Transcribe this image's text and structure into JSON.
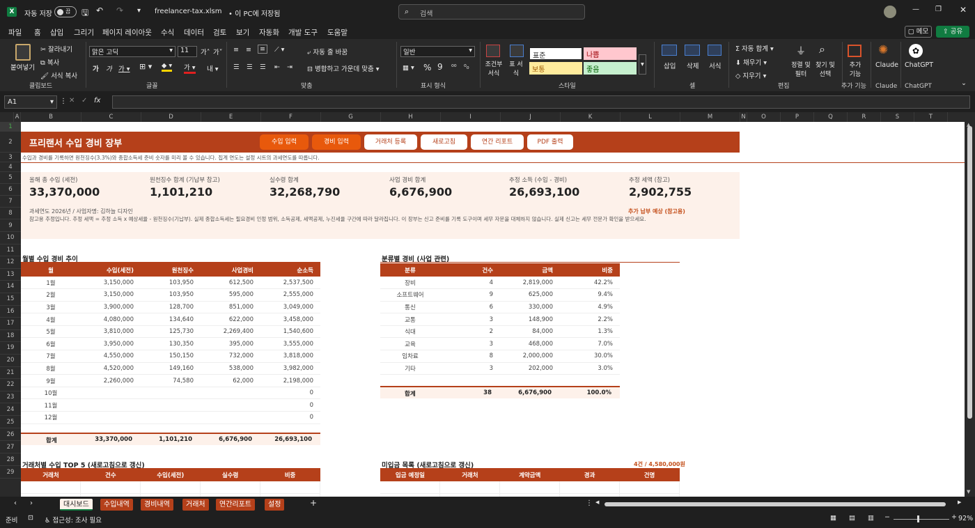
{
  "titlebar": {
    "autosave_label": "자동 저장",
    "autosave_state": "끔",
    "filename": "freelancer-tax.xlsm",
    "saved_status": "• 이 PC에 저장됨",
    "search_placeholder": "검색"
  },
  "menu": [
    "파일",
    "홈",
    "삽입",
    "그리기",
    "페이지 레이아웃",
    "수식",
    "데이터",
    "검토",
    "보기",
    "자동화",
    "개발 도구",
    "도움말"
  ],
  "menu_right": {
    "comment": "메모",
    "share": "공유"
  },
  "ribbon": {
    "paste": "붙여넣기",
    "cut": "잘라내기",
    "copy": "복사",
    "format_painter": "서식 복사",
    "clipboard": "클립보드",
    "font_name": "맑은 고딕",
    "font_size": "11",
    "font_group": "글꼴",
    "wrap": "자동 줄 바꿈",
    "merge": "병합하고 가운데 맞춤",
    "align_group": "맞춤",
    "number_format": "일반",
    "number_group": "표시 형식",
    "cond_format": "조건부 서식",
    "table_format": "표 서식",
    "styles": [
      "표준",
      "나쁨",
      "보통",
      "좋음"
    ],
    "styles_group": "스타일",
    "insert": "삽입",
    "delete": "삭제",
    "format": "서식",
    "cells_group": "셀",
    "autosum": "자동 합계",
    "fill": "채우기",
    "clear": "지우기",
    "sort": "정렬 및 필터",
    "find": "찾기 및 선택",
    "edit_group": "편집",
    "addins": "추가 기능",
    "addins_group": "추가 기능",
    "claude": "Claude",
    "claude_group": "Claude",
    "chatgpt": "ChatGPT",
    "chatgpt_group": "ChatGPT"
  },
  "formula": {
    "cell_ref": "A1",
    "fx": "fx",
    "content": ""
  },
  "columns": [
    "A",
    "B",
    "C",
    "D",
    "E",
    "F",
    "G",
    "H",
    "I",
    "J",
    "K",
    "L",
    "M",
    "N",
    "O",
    "P",
    "Q",
    "R",
    "S",
    "T"
  ],
  "rows": [
    "1",
    "2",
    "3",
    "4",
    "5",
    "6",
    "7",
    "8",
    "9",
    "10",
    "11",
    "12",
    "13",
    "14",
    "15",
    "16",
    "17",
    "18",
    "19",
    "20",
    "21",
    "22",
    "23",
    "24",
    "25",
    "26",
    "27",
    "28",
    "29"
  ],
  "header": {
    "title": "프리랜서 수입 경비 장부",
    "buttons": [
      "수입 입력",
      "경비 입력",
      "거래처 등록",
      "새로고침",
      "연간 리포트",
      "PDF 출력"
    ],
    "subtitle": "수입과 경비를 기록하면 원천징수(3.3%)와 종합소득세 준비 숫자를 미리 볼 수 있습니다. 집계 연도는 설정 시트의 과세연도를 따릅니다."
  },
  "kpis": [
    {
      "label": "올해 총 수입 (세전)",
      "value": "33,370,000"
    },
    {
      "label": "원천징수 합계 (기납부 참고)",
      "value": "1,101,210"
    },
    {
      "label": "실수령 합계",
      "value": "32,268,790"
    },
    {
      "label": "사업 경비 합계",
      "value": "6,676,900"
    },
    {
      "label": "추정 소득 (수입 - 경비)",
      "value": "26,693,100"
    },
    {
      "label": "추정 세액 (참고)",
      "value": "2,902,755"
    }
  ],
  "info": {
    "meta": "과세연도 2026년  /  사업자명: 김하늘 디자인",
    "tax_note": "추가 납부 예상 (참고용)",
    "disclaimer": "참고용 추정입니다. 추정 세액 = 추정 소득 x 예상세율 - 원천징수(기납부). 실제 종합소득세는 필요경비 인정 범위, 소득공제, 세액공제, 누진세율 구간에 따라 달라집니다. 이 장부는 신고 준비를 기록 도구이며 세무 자문을 대체하지 않습니다. 실제 신고는 세무 전문가 확인을 받으세요."
  },
  "monthly": {
    "title": "월별 수입 경비 추이",
    "headers": [
      "월",
      "수입(세전)",
      "원천징수",
      "사업경비",
      "순소득"
    ],
    "rows": [
      [
        "1월",
        "3,150,000",
        "103,950",
        "612,500",
        "2,537,500"
      ],
      [
        "2월",
        "3,150,000",
        "103,950",
        "595,000",
        "2,555,000"
      ],
      [
        "3월",
        "3,900,000",
        "128,700",
        "851,000",
        "3,049,000"
      ],
      [
        "4월",
        "4,080,000",
        "134,640",
        "622,000",
        "3,458,000"
      ],
      [
        "5월",
        "3,810,000",
        "125,730",
        "2,269,400",
        "1,540,600"
      ],
      [
        "6월",
        "3,950,000",
        "130,350",
        "395,000",
        "3,555,000"
      ],
      [
        "7월",
        "4,550,000",
        "150,150",
        "732,000",
        "3,818,000"
      ],
      [
        "8월",
        "4,520,000",
        "149,160",
        "538,000",
        "3,982,000"
      ],
      [
        "9월",
        "2,260,000",
        "74,580",
        "62,000",
        "2,198,000"
      ],
      [
        "10월",
        "",
        "",
        "",
        "0"
      ],
      [
        "11월",
        "",
        "",
        "",
        "0"
      ],
      [
        "12월",
        "",
        "",
        "",
        "0"
      ]
    ],
    "total": [
      "합계",
      "33,370,000",
      "1,101,210",
      "6,676,900",
      "26,693,100"
    ]
  },
  "category": {
    "title": "분류별 경비 (사업 관련)",
    "headers": [
      "분류",
      "건수",
      "금액",
      "비중"
    ],
    "rows": [
      [
        "장비",
        "4",
        "2,819,000",
        "42.2%"
      ],
      [
        "소프트웨어",
        "9",
        "625,000",
        "9.4%"
      ],
      [
        "통신",
        "6",
        "330,000",
        "4.9%"
      ],
      [
        "교통",
        "3",
        "148,900",
        "2.2%"
      ],
      [
        "식대",
        "2",
        "84,000",
        "1.3%"
      ],
      [
        "교육",
        "3",
        "468,000",
        "7.0%"
      ],
      [
        "임차료",
        "8",
        "2,000,000",
        "30.0%"
      ],
      [
        "기타",
        "3",
        "202,000",
        "3.0%"
      ]
    ],
    "total": [
      "합계",
      "38",
      "6,676,900",
      "100.0%"
    ]
  },
  "top5": {
    "title": "거래처별 수입 TOP 5 (새로고침으로 갱신)",
    "headers": [
      "거래처",
      "건수",
      "수입(세전)",
      "실수령",
      "비중"
    ]
  },
  "unpaid": {
    "title": "미입금 목록 (새로고침으로 갱신)",
    "summary": "4건 / 4,580,000원",
    "headers": [
      "입금 예정일",
      "거래처",
      "계약금액",
      "경과",
      "건명"
    ]
  },
  "tabs": [
    "대시보드",
    "수입내역",
    "경비내역",
    "거래처",
    "연간리포트",
    "설정"
  ],
  "status": {
    "ready": "준비",
    "accessibility": "접근성: 조사 필요",
    "zoom": "92%"
  },
  "colors": {
    "accent": "#b5401a",
    "button": "#e8590c",
    "kpi_bg": "#fdf1ea",
    "excel_green": "#107c41"
  }
}
